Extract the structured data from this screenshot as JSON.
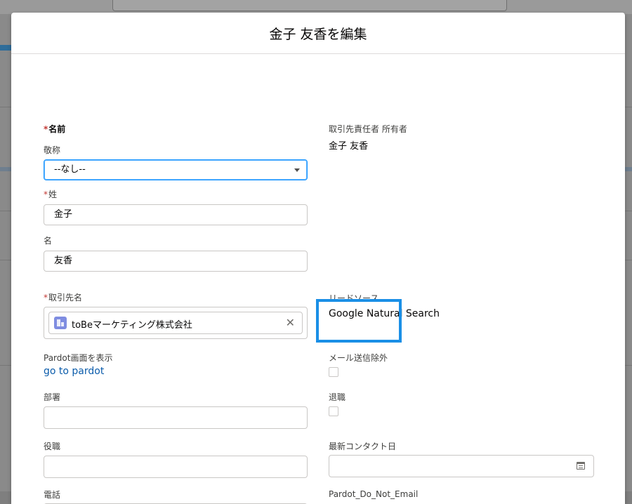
{
  "modal": {
    "title": "金子 友香を編集"
  },
  "left": {
    "name_label": "名前",
    "salutation": {
      "label": "敬称",
      "value": "--なし--"
    },
    "last_name": {
      "label": "姓",
      "value": "金子"
    },
    "first_name": {
      "label": "名",
      "value": "友香"
    },
    "account": {
      "label": "取引先名",
      "value": "toBeマーケティング株式会社"
    },
    "pardot": {
      "label": "Pardot画面を表示",
      "link": "go to pardot"
    },
    "department": {
      "label": "部署",
      "value": ""
    },
    "title": {
      "label": "役職",
      "value": ""
    },
    "phone": {
      "label": "電話",
      "value": ""
    }
  },
  "right": {
    "owner": {
      "label": "取引先責任者 所有者",
      "value": "金子 友香"
    },
    "lead_source": {
      "label": "リードソース",
      "value": "Google Natural Search"
    },
    "email_opt_out": {
      "label": "メール送信除外",
      "checked": false
    },
    "retired": {
      "label": "退職",
      "checked": false
    },
    "last_contact": {
      "label": "最新コンタクト日",
      "value": ""
    },
    "pardot_do_not_email": {
      "label": "Pardot_Do_Not_Email",
      "checked": false
    }
  },
  "required_mark": "*",
  "colors": {
    "accent": "#1a8fe6",
    "link": "#0b5cab",
    "required": "#c23934"
  }
}
